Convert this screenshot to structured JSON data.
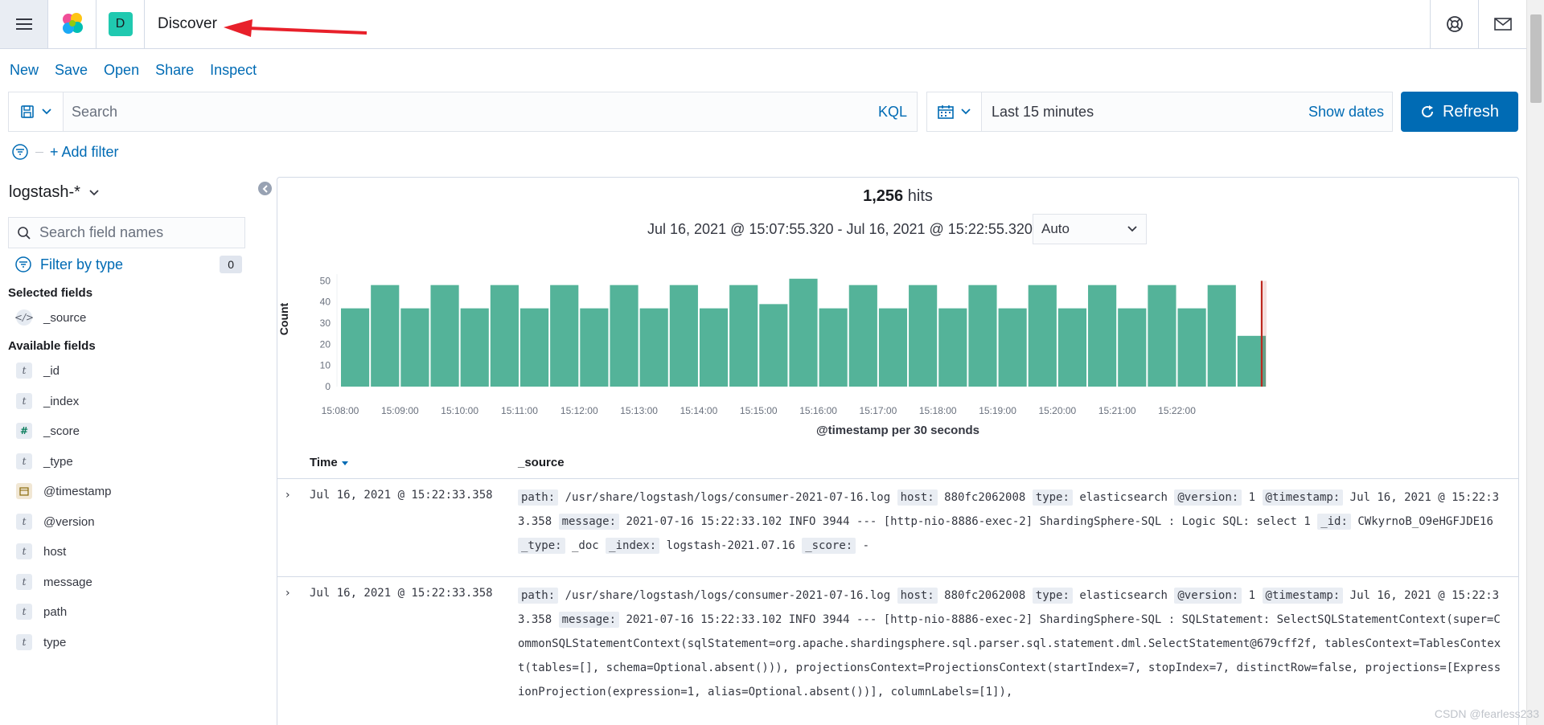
{
  "header": {
    "page_title": "Discover",
    "space_initial": "D"
  },
  "toolbar": {
    "items": [
      "New",
      "Save",
      "Open",
      "Share",
      "Inspect"
    ]
  },
  "query": {
    "placeholder": "Search",
    "language": "KQL"
  },
  "time": {
    "range_label": "Last 15 minutes",
    "show_dates": "Show dates",
    "refresh_label": "Refresh"
  },
  "filters": {
    "add_filter": "+ Add filter"
  },
  "sidebar": {
    "index_pattern": "logstash-*",
    "search_placeholder": "Search field names",
    "filter_by_type": "Filter by type",
    "filter_count": "0",
    "selected_title": "Selected fields",
    "selected_fields": [
      {
        "name": "_source",
        "icon": "code-icon"
      }
    ],
    "available_title": "Available fields",
    "available_fields": [
      {
        "name": "_id",
        "icon": "t"
      },
      {
        "name": "_index",
        "icon": "t"
      },
      {
        "name": "_score",
        "icon": "#"
      },
      {
        "name": "_type",
        "icon": "t"
      },
      {
        "name": "@timestamp",
        "icon": "calendar-icon"
      },
      {
        "name": "@version",
        "icon": "t"
      },
      {
        "name": "host",
        "icon": "t"
      },
      {
        "name": "message",
        "icon": "t"
      },
      {
        "name": "path",
        "icon": "t"
      },
      {
        "name": "type",
        "icon": "t"
      }
    ]
  },
  "results": {
    "hits_count": "1,256",
    "hits_label": "hits",
    "time_range": "Jul 16, 2021 @ 15:07:55.320 - Jul 16, 2021 @ 15:22:55.320",
    "interval": "Auto",
    "col_time": "Time",
    "col_source": "_source"
  },
  "chart_data": {
    "type": "bar",
    "xlabel": "@timestamp per 30 seconds",
    "ylabel": "Count",
    "ylim": [
      0,
      50
    ],
    "yticks": [
      0,
      10,
      20,
      30,
      40,
      50
    ],
    "xticks": [
      "15:08:00",
      "15:09:00",
      "15:10:00",
      "15:11:00",
      "15:12:00",
      "15:13:00",
      "15:14:00",
      "15:15:00",
      "15:16:00",
      "15:17:00",
      "15:18:00",
      "15:19:00",
      "15:20:00",
      "15:21:00",
      "15:22:00"
    ],
    "values": [
      37,
      48,
      37,
      48,
      37,
      48,
      37,
      48,
      37,
      48,
      37,
      48,
      37,
      48,
      39,
      51,
      37,
      48,
      37,
      48,
      37,
      48,
      37,
      48,
      37,
      48,
      37,
      48,
      37,
      48,
      24
    ],
    "bar_color": "#54b399",
    "marker_color": "#bd271e"
  },
  "rows": [
    {
      "time": "Jul 16, 2021 @ 15:22:33.358",
      "parts": [
        {
          "k": "path:",
          "v": "/usr/share/logstash/logs/consumer-2021-07-16.log"
        },
        {
          "k": "host:",
          "v": "880fc2062008"
        },
        {
          "k": "type:",
          "v": "elasticsearch"
        },
        {
          "k": "@version:",
          "v": "1"
        },
        {
          "k": "@timestamp:",
          "v": "Jul 16, 2021 @ 15:22:33.358"
        },
        {
          "k": "message:",
          "v": "2021-07-16 15:22:33.102 INFO 3944 --- [http-nio-8886-exec-2] ShardingSphere-SQL : Logic SQL: select 1"
        },
        {
          "k": "_id:",
          "v": "CWkyrnoB_O9eHGFJDE16"
        },
        {
          "k": "_type:",
          "v": "_doc"
        },
        {
          "k": "_index:",
          "v": "logstash-2021.07.16"
        },
        {
          "k": "_score:",
          "v": " -"
        }
      ]
    },
    {
      "time": "Jul 16, 2021 @ 15:22:33.358",
      "parts": [
        {
          "k": "path:",
          "v": "/usr/share/logstash/logs/consumer-2021-07-16.log"
        },
        {
          "k": "host:",
          "v": "880fc2062008"
        },
        {
          "k": "type:",
          "v": "elasticsearch"
        },
        {
          "k": "@version:",
          "v": "1"
        },
        {
          "k": "@timestamp:",
          "v": "Jul 16, 2021 @ 15:22:33.358"
        },
        {
          "k": "message:",
          "v": "2021-07-16 15:22:33.102 INFO 3944 --- [http-nio-8886-exec-2] ShardingSphere-SQL : SQLStatement: SelectSQLStatementContext(super=CommonSQLStatementContext(sqlStatement=org.apache.shardingsphere.sql.parser.sql.statement.dml.SelectStatement@679cff2f, tablesContext=TablesContext(tables=[], schema=Optional.absent())), projectionsContext=ProjectionsContext(startIndex=7, stopIndex=7, distinctRow=false, projections=[ExpressionProjection(expression=1, alias=Optional.absent())], columnLabels=[1]),"
        }
      ]
    }
  ],
  "watermark": "CSDN @fearless233"
}
